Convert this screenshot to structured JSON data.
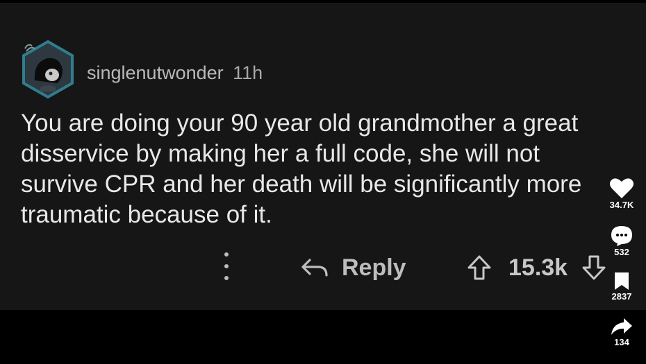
{
  "comment": {
    "username": "singlenutwonder",
    "time": "11h",
    "text": "You are doing your 90 year old grandmother a great disservice by making her a full code, she will not survive CPR and her death will be significantly more traumatic because of it."
  },
  "actions": {
    "reply_label": "Reply",
    "score": "15.3k"
  },
  "side_rail": {
    "likes": "34.7K",
    "comments": "532",
    "bookmarks": "2837",
    "shares": "134"
  },
  "colors": {
    "card_background": "#161616",
    "page_background": "#000000",
    "text": "#e8e8e8",
    "muted_text": "#b9b9b9",
    "avatar_ring": "#2f7e8c"
  },
  "icons": [
    "avatar",
    "more-vertical-icon",
    "reply-arrow-icon",
    "upvote-arrow-icon",
    "downvote-arrow-icon",
    "heart-icon",
    "comment-bubble-icon",
    "bookmark-icon",
    "share-arrow-icon"
  ]
}
